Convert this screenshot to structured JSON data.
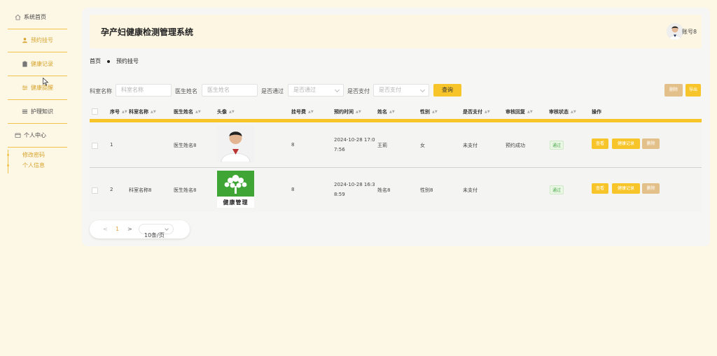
{
  "sidebar": {
    "home": "系统首页",
    "items": [
      "预约挂号",
      "健康记录",
      "健康提醒",
      "护理知识"
    ],
    "center": "个人中心",
    "sub": [
      "修改密码",
      "个人信息"
    ]
  },
  "header": {
    "title": "孕产妇健康检测管理系统",
    "account": "账号8"
  },
  "breadcrumb": [
    "首页",
    "预约挂号"
  ],
  "search": {
    "dept_label": "科室名称",
    "dept_placeholder": "科室名称",
    "doctor_label": "医生姓名",
    "doctor_placeholder": "医生姓名",
    "pass_label": "是否通过",
    "pass_placeholder": "是否通过",
    "paid_label": "是否支付",
    "paid_placeholder": "是否支付",
    "query": "查询",
    "delete": "删除",
    "export": "导出"
  },
  "table": {
    "headers": [
      "序号",
      "科室名称",
      "医生姓名",
      "头像",
      "挂号费",
      "预约时间",
      "姓名",
      "性别",
      "是否支付",
      "审核回复",
      "审核状态",
      "操作"
    ],
    "rows": [
      {
        "no": "1",
        "dept": "",
        "doctor": "医生姓名8",
        "fee": "8",
        "time1": "2024-10-28 17:0",
        "time2": "7:56",
        "name": "王莉",
        "gender": "女",
        "paid": "未支付",
        "reply": "预约成功",
        "status": "通过",
        "view": "查看",
        "record": "健康记录",
        "del": "删除"
      },
      {
        "no": "2",
        "dept": "科室名称8",
        "doctor": "医生姓名8",
        "fee": "8",
        "time1": "2024-10-28 16:3",
        "time2": "8:59",
        "name": "姓名8",
        "gender": "性别8",
        "paid": "未支付",
        "reply": "",
        "status": "通过",
        "view": "查看",
        "record": "健康记录",
        "del": "删除",
        "logo_text": "健康管理"
      }
    ]
  },
  "pager": {
    "prev": "<",
    "page": "1",
    "next": ">",
    "size": "10条/页"
  },
  "colors": {
    "accent": "#f7c52a",
    "bg": "#fdf7e6",
    "delete": "#e3c08a"
  }
}
